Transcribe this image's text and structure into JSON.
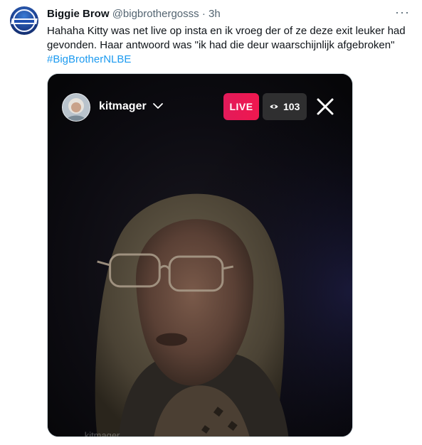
{
  "tweet": {
    "author_name": "Biggie Brow",
    "handle": "@bigbrothergosss",
    "separator": "·",
    "time": "3h",
    "more_label": "···",
    "text_line1": "Hahaha Kitty was net live op insta en ik vroeg der of ze deze exit leuker had",
    "text_line2": "gevonden. Haar antwoord was \"ik had die deur waarschijnlijk afgebroken\"",
    "hashtag": "#BigBrotherNLBE"
  },
  "live": {
    "username": "kitmager",
    "badge": "LIVE",
    "viewer_count": "103"
  },
  "colors": {
    "link": "#1d9bf0",
    "live_red": "#f0184f",
    "muted_text": "#536471"
  },
  "icons": {
    "more": "more-icon",
    "chevron": "chevron-down-icon",
    "eye": "eye-icon",
    "close": "close-icon"
  }
}
